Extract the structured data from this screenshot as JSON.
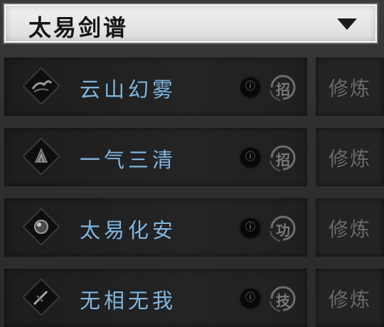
{
  "header": {
    "title": "太易剑谱"
  },
  "skills": [
    {
      "name": "云山幻雾",
      "type": "招",
      "action": "修炼",
      "icon": "mountain-mist-icon"
    },
    {
      "name": "一气三清",
      "type": "招",
      "action": "修炼",
      "icon": "peak-icon"
    },
    {
      "name": "太易化安",
      "type": "功",
      "action": "修炼",
      "icon": "orb-icon"
    },
    {
      "name": "无相无我",
      "type": "技",
      "action": "修炼",
      "icon": "blade-icon"
    }
  ],
  "colors": {
    "skill_name": "#7fb6e0",
    "header_bg": "#ecece9"
  }
}
